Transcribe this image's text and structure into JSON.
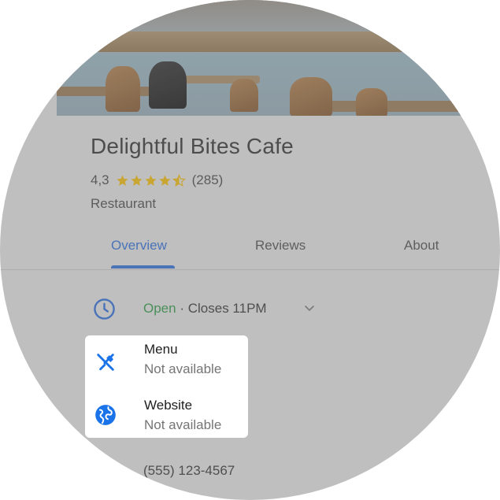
{
  "place": {
    "name": "Delightful Bites Cafe",
    "rating": "4,3",
    "stars": 4.3,
    "review_count": "(285)",
    "category": "Restaurant"
  },
  "tabs": [
    {
      "label": "Overview",
      "active": true
    },
    {
      "label": "Reviews",
      "active": false
    },
    {
      "label": "About",
      "active": false
    }
  ],
  "hours": {
    "status": "Open",
    "separator": "·",
    "closes": "Closes 11PM"
  },
  "popup": {
    "menu_label": "Menu",
    "menu_value": "Not available",
    "website_label": "Website",
    "website_value": "Not available"
  },
  "phone": "(555) 123-4567",
  "colors": {
    "accent": "#4a73b8",
    "open_green": "#4b8f5a",
    "star_gold": "#c9a531",
    "icon_blue": "#1a73e8"
  },
  "icons": [
    "clock-icon",
    "chevron-down-icon",
    "fork-knife-icon",
    "globe-icon",
    "star-icon"
  ]
}
